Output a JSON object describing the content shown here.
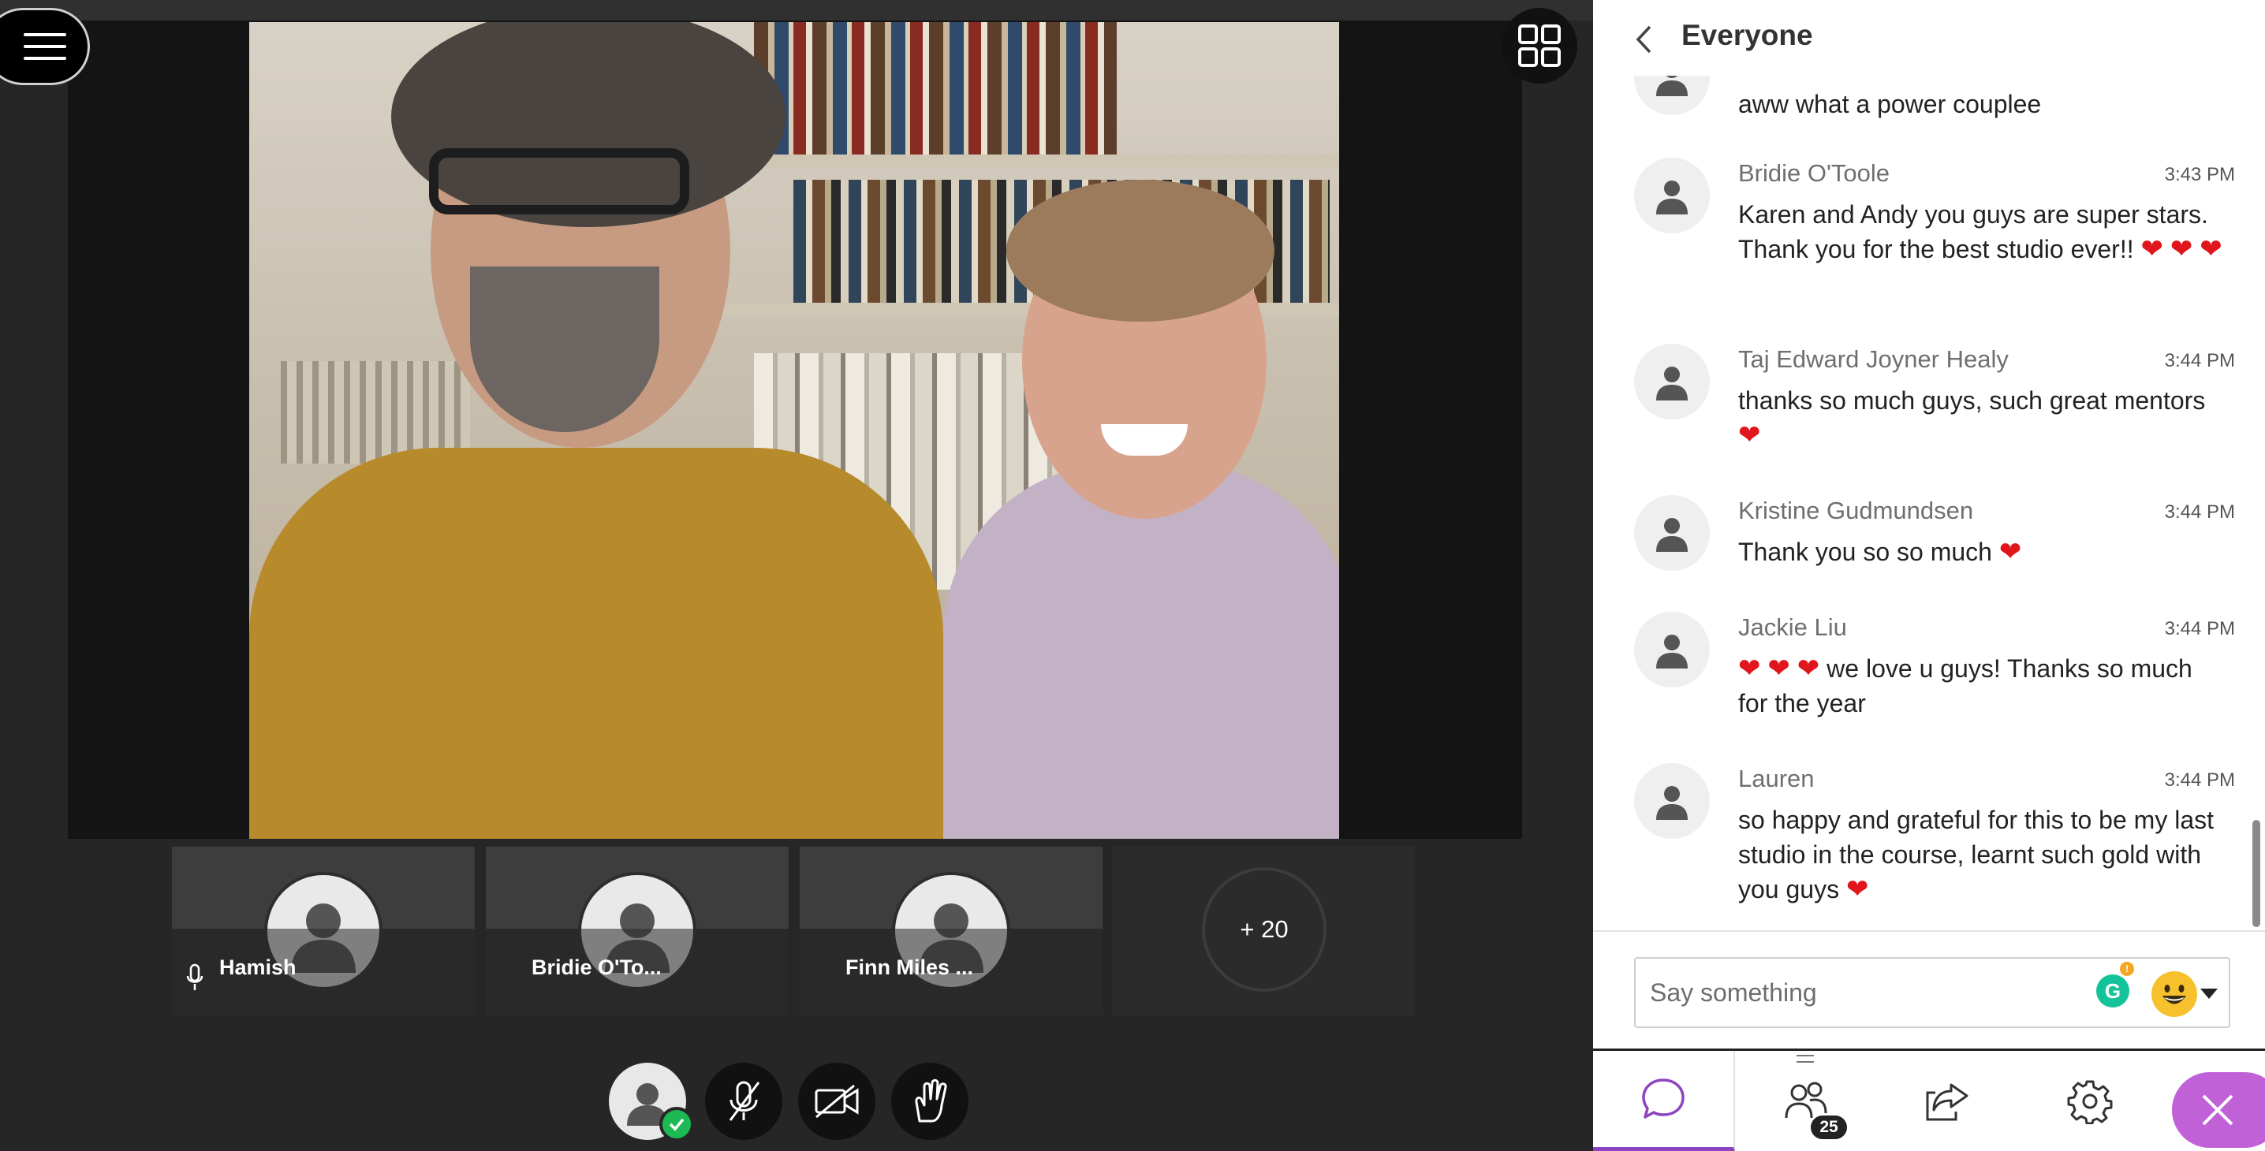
{
  "window": {
    "panel_title": "Everyone"
  },
  "participants_strip": [
    {
      "name": "Hamish",
      "mic": true
    },
    {
      "name": "Bridie O'To...",
      "mic": false
    },
    {
      "name": "Finn Miles ...",
      "mic": false
    }
  ],
  "more_participants_label": "+ 20",
  "chat": {
    "partial_top_message": "aww what a power couplee",
    "messages": [
      {
        "author": "Bridie O'Toole",
        "time": "3:43 PM",
        "text": "Karen and Andy you guys are super stars. Thank you for the best studio ever!!",
        "hearts_after": 3
      },
      {
        "author": "Taj Edward Joyner Healy",
        "time": "3:44 PM",
        "text": "thanks so much guys, such great mentors",
        "hearts_after": 1
      },
      {
        "author": "Kristine Gudmundsen",
        "time": "3:44 PM",
        "text": "Thank you so so much",
        "hearts_after": 1
      },
      {
        "author": "Jackie Liu",
        "time": "3:44 PM",
        "hearts_before": 3,
        "text": "we love u guys! Thanks so much for the year"
      },
      {
        "author": "Lauren",
        "time": "3:44 PM",
        "text": "so happy and grateful for this to be my last studio in the course, learnt such gold with you guys",
        "hearts_after": 1
      }
    ],
    "composer_placeholder": "Say something"
  },
  "tabs": {
    "participant_count": "25"
  },
  "icons": {
    "menu": "hamburger-menu-icon",
    "layout": "grid-layout-icon",
    "back": "chevron-left-icon",
    "mic_off": "microphone-muted-icon",
    "camera_off": "camera-off-icon",
    "raise_hand": "raise-hand-icon",
    "chat": "chat-bubble-icon",
    "participants": "people-icon",
    "share": "share-icon",
    "settings": "gear-icon",
    "close": "close-icon",
    "emoji": "smiley-emoji-icon",
    "grammarly": "grammarly-icon"
  },
  "colors": {
    "accent": "#8e44c0",
    "close_button": "#c061d8",
    "heart": "#e0161c",
    "status_ok": "#1db954"
  }
}
